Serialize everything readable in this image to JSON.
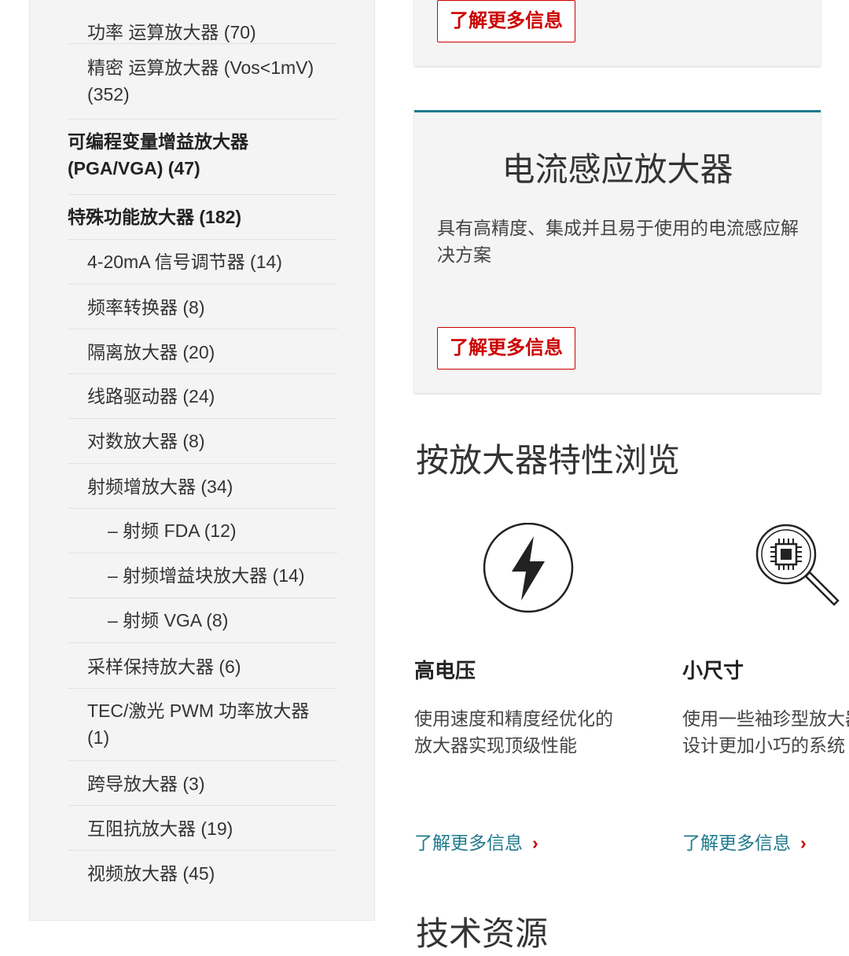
{
  "sidebar": {
    "items": [
      {
        "label": "功率 运算放大器 (70)",
        "level": 2
      },
      {
        "label": "精密 运算放大器 (Vos<1mV) (352)",
        "level": 2
      },
      {
        "label": "可编程变量增益放大器 (PGA/VGA) (47)",
        "level": 1
      },
      {
        "label": "特殊功能放大器 (182)",
        "level": 1
      },
      {
        "label": "4-20mA 信号调节器 (14)",
        "level": 2
      },
      {
        "label": "频率转换器 (8)",
        "level": 2
      },
      {
        "label": "隔离放大器 (20)",
        "level": 2
      },
      {
        "label": "线路驱动器 (24)",
        "level": 2
      },
      {
        "label": "对数放大器 (8)",
        "level": 2
      },
      {
        "label": "射频增放大器 (34)",
        "level": 2
      },
      {
        "label": "– 射频 FDA (12)",
        "level": 3
      },
      {
        "label": "– 射频增益块放大器 (14)",
        "level": 3
      },
      {
        "label": "– 射频 VGA (8)",
        "level": 3
      },
      {
        "label": "采样保持放大器 (6)",
        "level": 2
      },
      {
        "label": "TEC/激光 PWM 功率放大器 (1)",
        "level": 2
      },
      {
        "label": "跨导放大器 (3)",
        "level": 2
      },
      {
        "label": "互阻抗放大器 (19)",
        "level": 2
      },
      {
        "label": "视频放大器 (45)",
        "level": 2
      }
    ]
  },
  "top_card": {
    "button_label": "了解更多信息"
  },
  "current_sense_card": {
    "title": "电流感应放大器",
    "description": "具有高精度、集成并且易于使用的电流感应解决方案",
    "button_label": "了解更多信息"
  },
  "browse_section": {
    "title": "按放大器特性浏览",
    "features": [
      {
        "icon": "lightning-bolt-icon",
        "title": "高电压",
        "description_line1": "使用速度和精度经优化的",
        "description_line2": "放大器实现顶级性能",
        "link_label": "了解更多信息",
        "link_chevron": "›"
      },
      {
        "icon": "chip-magnifier-icon",
        "title": "小尺寸",
        "description_line1": "使用一些袖珍型放大器",
        "description_line2": "设计更加小巧的系统",
        "link_label": "了解更多信息",
        "link_chevron": "›"
      }
    ]
  },
  "resources_section": {
    "title": "技术资源"
  },
  "colors": {
    "accent_red": "#cc0000",
    "accent_teal": "#1f7a8c",
    "panel_bg": "#f4f4f4"
  }
}
